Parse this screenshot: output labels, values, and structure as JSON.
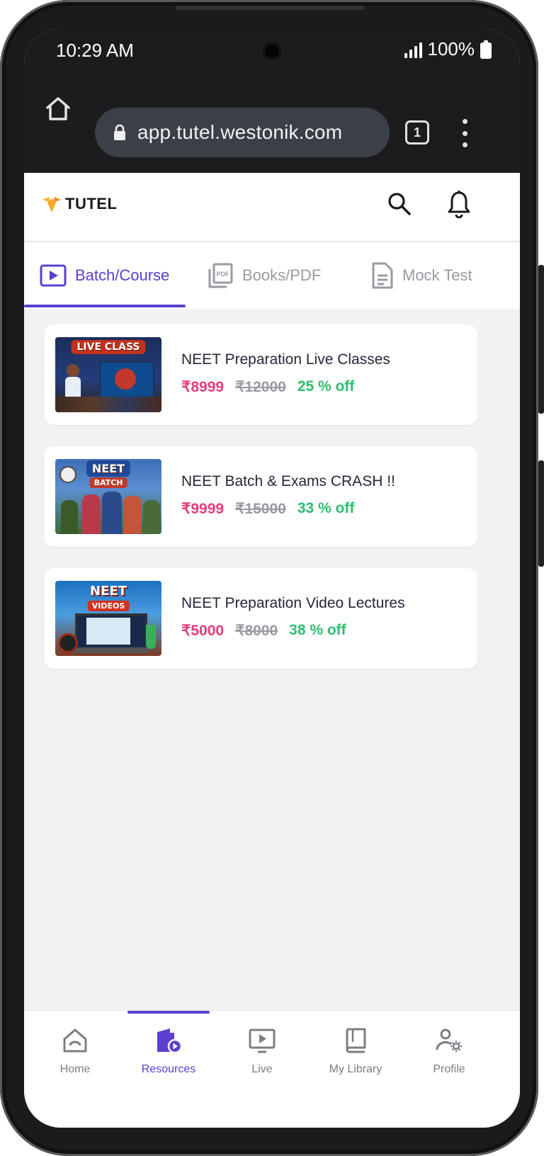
{
  "status": {
    "time": "10:29 AM",
    "battery": "100%"
  },
  "browser": {
    "url": "app.tutel.westonik.com",
    "tab_count": "1"
  },
  "app": {
    "logo_text": "TUTEL"
  },
  "tabs": [
    {
      "label": "Batch/Course",
      "icon": "play-square-icon",
      "active": true
    },
    {
      "label": "Books/PDF",
      "icon": "pdf-icon",
      "active": false
    },
    {
      "label": "Mock Test",
      "icon": "document-icon",
      "active": false
    }
  ],
  "courses": [
    {
      "title": "NEET Preparation Live Classes",
      "price": "₹8999",
      "old_price": "₹12000",
      "discount": "25 % off",
      "thumb_label": "LIVE CLASS"
    },
    {
      "title": "NEET Batch & Exams CRASH !!",
      "price": "₹9999",
      "old_price": "₹15000",
      "discount": "33 % off",
      "thumb_label": "NEET",
      "thumb_sub": "BATCH"
    },
    {
      "title": "NEET Preparation Video Lectures",
      "price": "₹5000",
      "old_price": "₹8000",
      "discount": "38 % off",
      "thumb_label": "NEET",
      "thumb_sub": "VIDEOS"
    }
  ],
  "bottom_nav": [
    {
      "label": "Home",
      "icon": "home-icon",
      "active": false
    },
    {
      "label": "Resources",
      "icon": "resources-icon",
      "active": true
    },
    {
      "label": "Live",
      "icon": "live-icon",
      "active": false
    },
    {
      "label": "My Library",
      "icon": "library-icon",
      "active": false
    },
    {
      "label": "Profile",
      "icon": "profile-settings-icon",
      "active": false
    }
  ],
  "colors": {
    "accent": "#5b3fd0",
    "price": "#e23e7a",
    "discount": "#2dbd6e"
  }
}
